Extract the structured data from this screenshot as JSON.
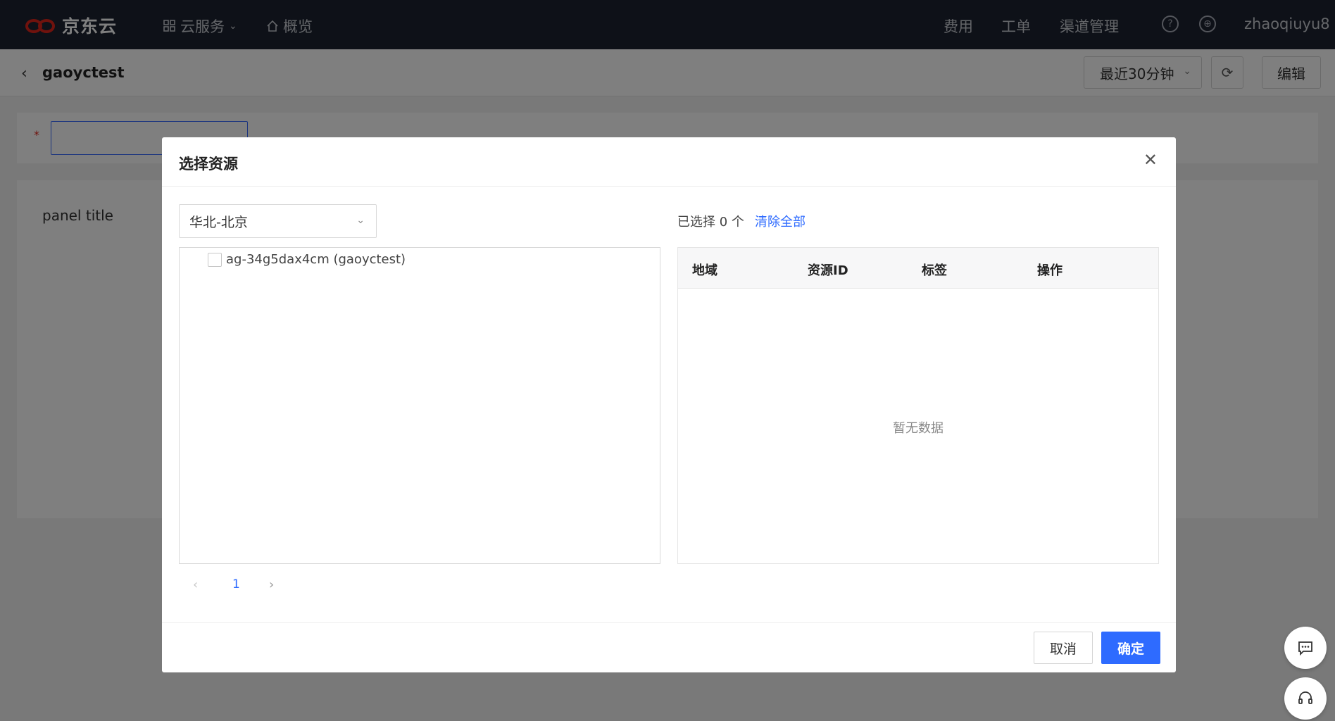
{
  "topnav": {
    "logo_text": "京东云",
    "cloud_services": "云服务",
    "overview": "概览",
    "billing": "费用",
    "tickets": "工单",
    "channel_mgmt": "渠道管理",
    "help_icon_glyph": "?",
    "lang_icon_glyph": "⊕",
    "username": "zhaoqiuyu8"
  },
  "subheader": {
    "back_glyph": "‹",
    "title": "gaoyctest",
    "time_range": "最近30分钟",
    "refresh_glyph": "⟳",
    "edit": "编辑"
  },
  "background": {
    "required_mark": "*",
    "panel_title": "panel title"
  },
  "modal": {
    "title": "选择资源",
    "close_glyph": "✕",
    "region": "华北-北京",
    "tree_items": [
      {
        "label": "ag-34g5dax4cm (gaoyctest)",
        "checked": false
      }
    ],
    "pager": {
      "prev": "‹",
      "current": "1",
      "next": "›"
    },
    "selected_info": "已选择 0 个",
    "clear_all": "清除全部",
    "table": {
      "columns": [
        "地域",
        "资源ID",
        "标签",
        "操作"
      ],
      "empty_text": "暂无数据"
    },
    "cancel": "取消",
    "ok": "确定"
  },
  "colors": {
    "accent": "#2e6bff",
    "nav_bg": "#1c2230",
    "brand_red": "#e1251b"
  },
  "icons": {
    "grid": "grid-icon",
    "home": "home-icon",
    "chat": "chat-icon",
    "headset": "headset-icon"
  }
}
